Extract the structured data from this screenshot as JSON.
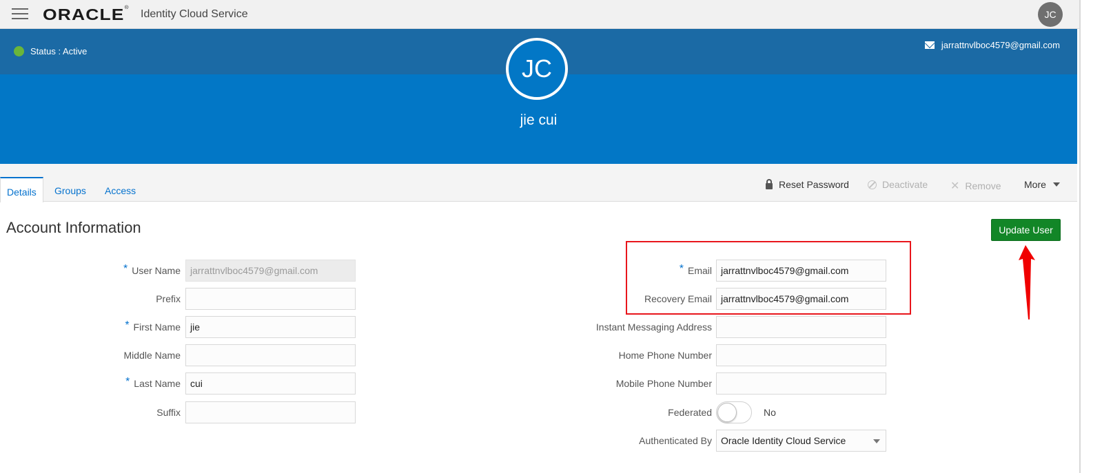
{
  "header": {
    "brand": "ORACLE",
    "brand_mark": "®",
    "app_title": "Identity Cloud Service",
    "avatar_initials": "JC"
  },
  "profile": {
    "status": "Status : Active",
    "status_color": "#6ab53a",
    "email": "jarrattnvlboc4579@gmail.com",
    "avatar_initials": "JC",
    "full_name": "jie cui"
  },
  "tabs": [
    "Details",
    "Groups",
    "Access"
  ],
  "actions": {
    "reset_password": "Reset Password",
    "deactivate": "Deactivate",
    "remove": "Remove",
    "more": "More"
  },
  "section": {
    "title": "Account Information",
    "update_button": "Update User"
  },
  "required_mark": "*",
  "form_left": {
    "user_name": {
      "label": "User Name",
      "value": "jarrattnvlboc4579@gmail.com"
    },
    "prefix": {
      "label": "Prefix",
      "value": ""
    },
    "first_name": {
      "label": "First Name",
      "value": "jie"
    },
    "middle_name": {
      "label": "Middle Name",
      "value": ""
    },
    "last_name": {
      "label": "Last Name",
      "value": "cui"
    },
    "suffix": {
      "label": "Suffix",
      "value": ""
    }
  },
  "form_right": {
    "email": {
      "label": "Email",
      "value": "jarrattnvlboc4579@gmail.com"
    },
    "recovery_email": {
      "label": "Recovery Email",
      "value": "jarrattnvlboc4579@gmail.com"
    },
    "im_address": {
      "label": "Instant Messaging Address",
      "value": ""
    },
    "home_phone": {
      "label": "Home Phone Number",
      "value": ""
    },
    "mobile_phone": {
      "label": "Mobile Phone Number",
      "value": ""
    },
    "federated": {
      "label": "Federated",
      "value": "No"
    },
    "authenticated_by": {
      "label": "Authenticated By",
      "value": "Oracle Identity Cloud Service"
    }
  },
  "colors": {
    "banner_dark": "#1b6aa5",
    "banner_light": "#0277c6",
    "accent": "#0572ce",
    "update_button": "#128627",
    "annotation": "#e8151b"
  }
}
